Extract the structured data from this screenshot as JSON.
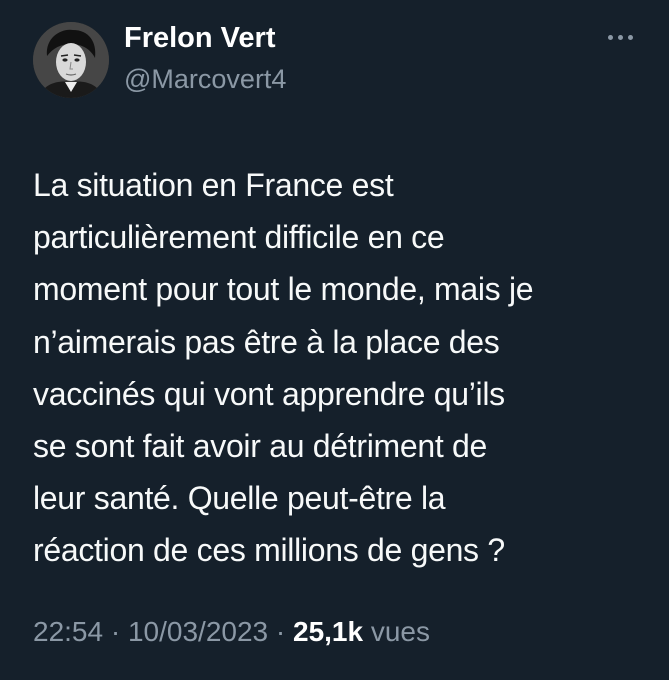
{
  "author": {
    "display_name": "Frelon Vert",
    "handle": "@Marcovert4",
    "avatar_icon": "profile-photo"
  },
  "more_icon": "more-horizontal-icon",
  "tweet": {
    "text": "La situation en France est\nparticulièrement difficile en ce\nmoment pour tout le monde, mais je\nn’aimerais pas être à la place des\nvaccinés qui vont apprendre qu’ils\nse sont fait avoir au détriment de\nleur santé. Quelle peut-être la\nréaction de ces millions de gens ?"
  },
  "meta": {
    "time": "22:54",
    "separator": " · ",
    "date": "10/03/2023",
    "views_count": "25,1k",
    "views_label": "vues"
  },
  "colors": {
    "background": "#15202b",
    "text": "#f7f9f9",
    "secondary": "#8b98a5"
  }
}
